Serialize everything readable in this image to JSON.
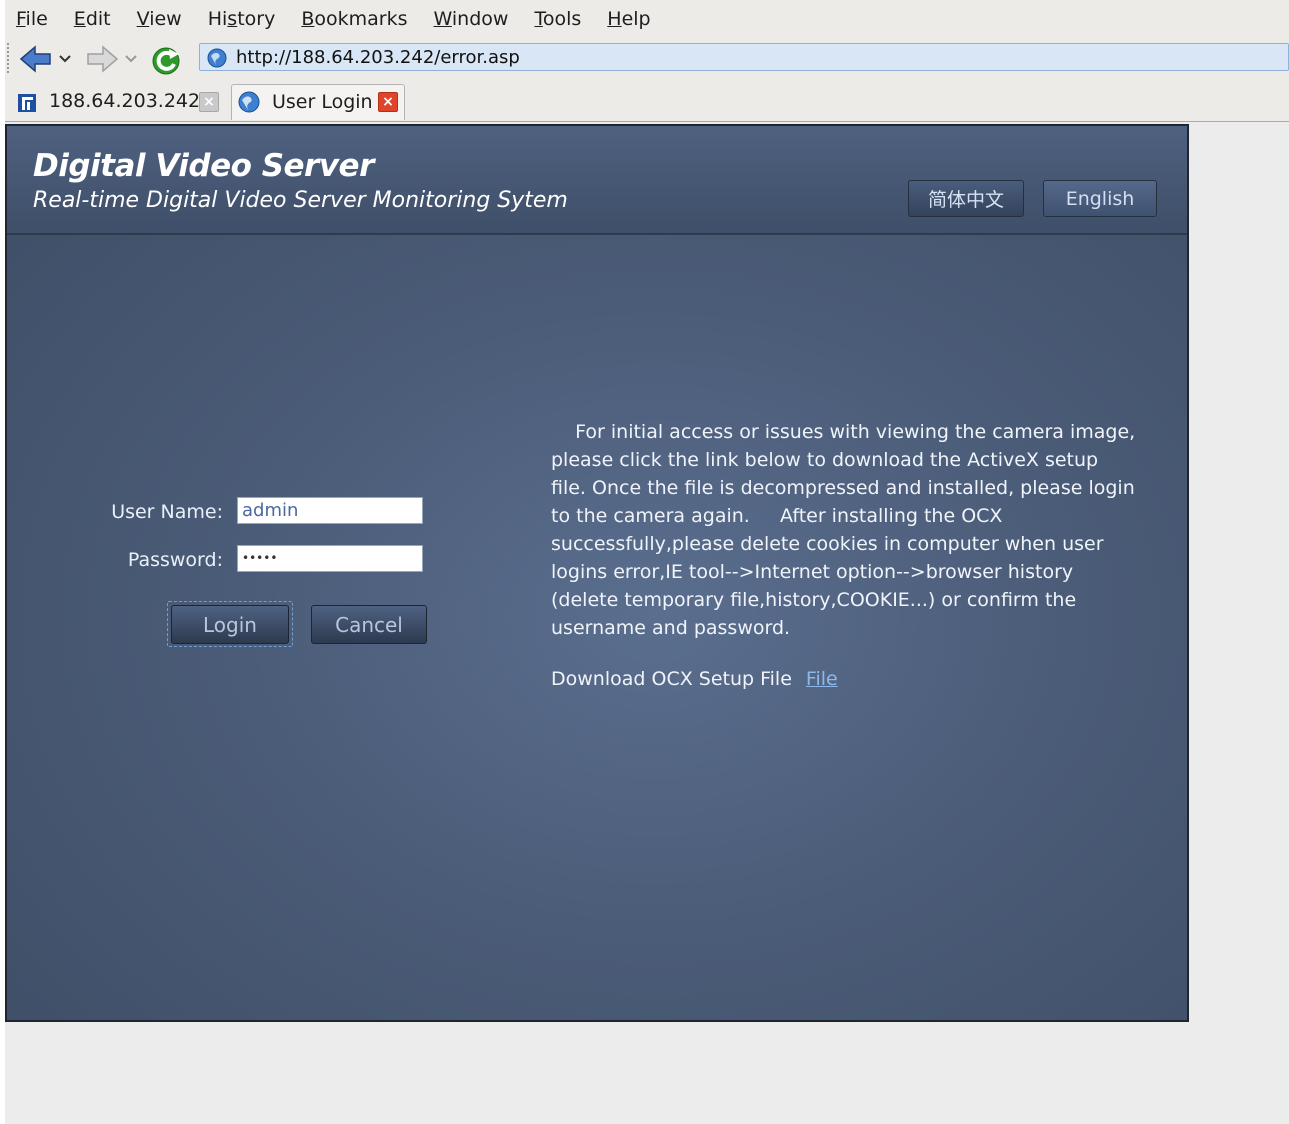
{
  "menu": [
    "File",
    "Edit",
    "View",
    "History",
    "Bookmarks",
    "Window",
    "Tools",
    "Help"
  ],
  "menu_mnemonics": [
    "F",
    "E",
    "V",
    "s",
    "B",
    "W",
    "T",
    "H"
  ],
  "nav": {
    "url": "http://188.64.203.242/error.asp"
  },
  "tabs": [
    {
      "label": "188.64.203.242"
    },
    {
      "label": "User Login"
    }
  ],
  "app": {
    "title": "Digital Video Server",
    "subtitle": "Real-time Digital Video Server Monitoring  Sytem",
    "lang_cn": "简体中文",
    "lang_en": "English"
  },
  "login": {
    "username_label": "User Name:",
    "username_value": "admin",
    "password_label": "Password:",
    "password_value": "•••••",
    "login_button": "Login",
    "cancel_button": "Cancel"
  },
  "info": {
    "lines": [
      "    For initial access or issues with viewing the camera image,",
      "please click the link below to download the ActiveX setup",
      "file. Once the file is decompressed and installed, please login",
      "to the camera again.     After installing the OCX",
      "successfully,please delete cookies in computer when user",
      "logins error,IE tool-->Internet option-->browser history",
      "(delete temporary file,history,COOKIE...) or confirm the",
      "username and password."
    ],
    "download_text": "Download OCX Setup File",
    "download_link": "File"
  },
  "colors": {
    "accent_blue": "#8fb8ea",
    "panel_bg": "#4b5c78",
    "tab_close_red": "#e0452b"
  }
}
